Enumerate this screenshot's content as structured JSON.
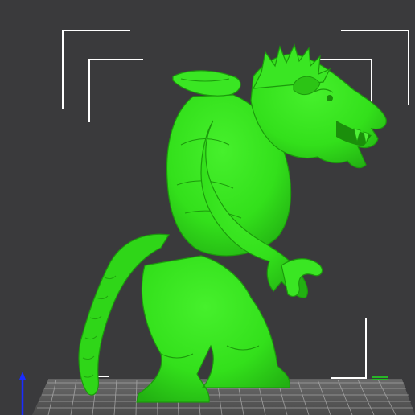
{
  "app": {
    "view": "3d-print-preview",
    "background_color": "#3a3a3c",
    "model_color": "#33e01b",
    "model_shadow_color": "#1f9e0f",
    "frame_color": "#ffffff",
    "grid_color": "#bdbdbd",
    "bed_color": "#5b5b5b"
  },
  "viewport": {
    "model_name_icon": "werewolf-rat-creature-model",
    "axis_icons": [
      "z-axis-arrow-icon",
      "x-axis-arrow-icon",
      "y-axis-arrow-icon"
    ]
  }
}
